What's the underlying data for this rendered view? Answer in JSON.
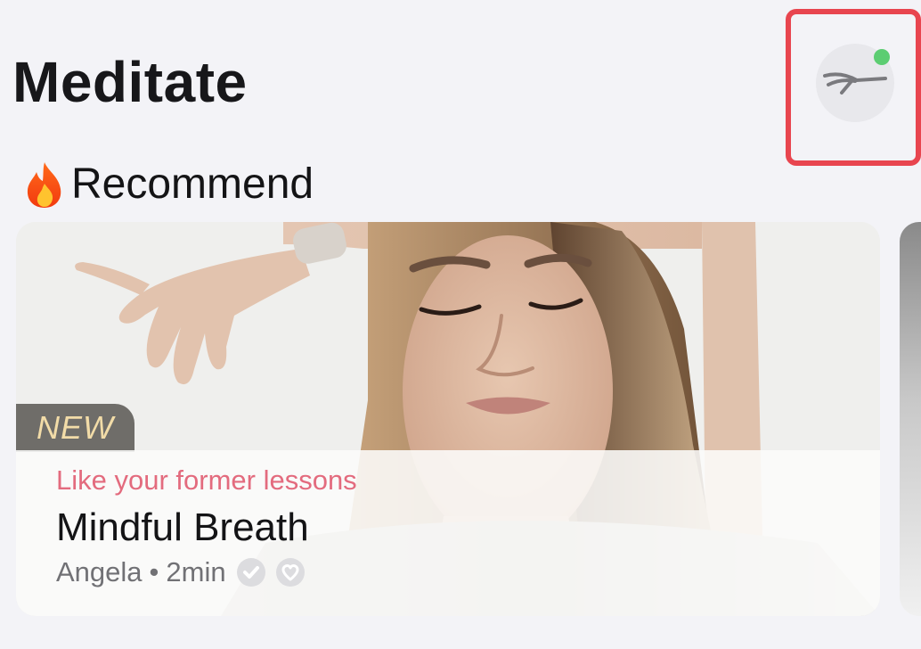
{
  "header": {
    "title": "Meditate"
  },
  "profile": {
    "icon": "yoga-pose-icon",
    "notification_dot_color": "#5ccd72",
    "highlight_color": "#e8454f"
  },
  "section": {
    "icon": "fire-icon",
    "title": "Recommend"
  },
  "cards": [
    {
      "badge": "NEW",
      "subtitle": "Like your former lessons",
      "title": "Mindful Breath",
      "author": "Angela",
      "separator": "•",
      "duration": "2min",
      "icons": [
        "checkmark-icon",
        "heart-icon"
      ]
    }
  ],
  "colors": {
    "background": "#f3f3f7",
    "subtitle_pink": "#e36b7e",
    "badge_text": "#f2dca8"
  }
}
